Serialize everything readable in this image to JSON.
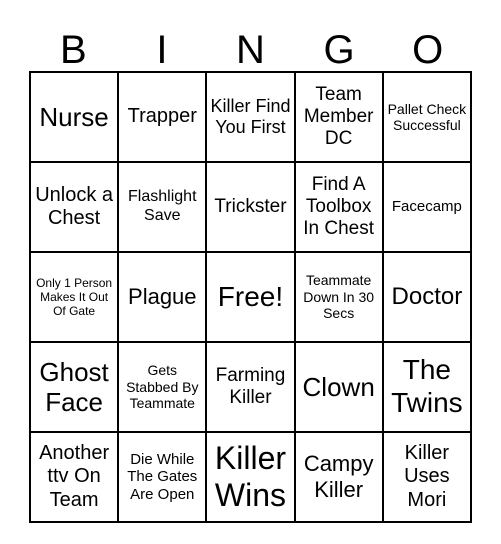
{
  "header": [
    "B",
    "I",
    "N",
    "G",
    "O"
  ],
  "cells": [
    [
      "Nurse",
      "Trapper",
      "Killer Find You First",
      "Team Member DC",
      "Pallet Check Successful"
    ],
    [
      "Unlock a Chest",
      "Flashlight Save",
      "Trickster",
      "Find A Toolbox In Chest",
      "Facecamp"
    ],
    [
      "Only 1 Person Makes It Out Of Gate",
      "Plague",
      "Free!",
      "Teammate Down In 30 Secs",
      "Doctor"
    ],
    [
      "Ghost Face",
      "Gets Stabbed By Teammate",
      "Farming Killer",
      "Clown",
      "The Twins"
    ],
    [
      "Another ttv On Team",
      "Die While The Gates Are Open",
      "Killer Wins",
      "Campy Killer",
      "Killer Uses Mori"
    ]
  ]
}
